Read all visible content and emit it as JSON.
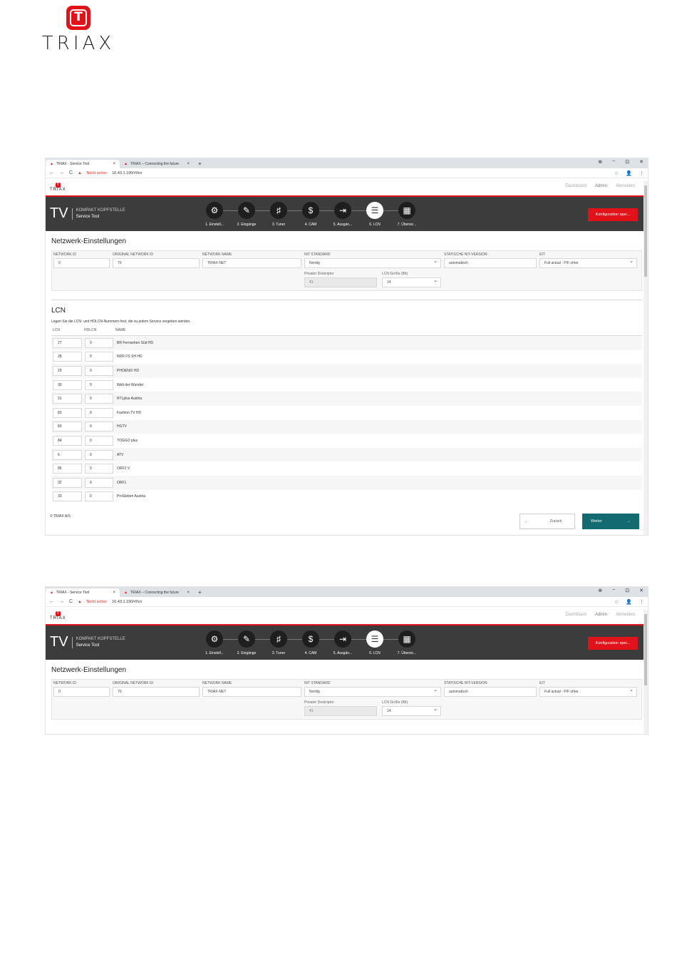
{
  "document_logo": {
    "mark": "T",
    "word": "TRIAX"
  },
  "browser": {
    "tabs": [
      {
        "title": "TRIAX - Service Tool"
      },
      {
        "title": "TRIAX – Connecting the future"
      }
    ],
    "new_tab": "+",
    "window_controls": [
      "⊗",
      "−",
      "⊡",
      "✕"
    ],
    "back": "←",
    "forward": "→",
    "reload": "C",
    "security_warning": "Nicht sicher",
    "url": "10.43.1.190/#/lcn",
    "star": "☆",
    "profile": "👤",
    "menu": "⋮"
  },
  "app": {
    "mini_logo_mark": "T",
    "mini_logo_word": "TRIAX",
    "top_links": [
      "Dashboard",
      "Admin",
      "Abmelden"
    ],
    "brand": {
      "tv": "TV",
      "line1": "KOMPAKT KOPFSTELLE",
      "line2": "Service Tool"
    },
    "steps": [
      {
        "icon": "⚙",
        "label": "1. Einstell..."
      },
      {
        "icon": "✎",
        "label": "2. Eingänge"
      },
      {
        "icon": "♯",
        "label": "3. Tuner"
      },
      {
        "icon": "$",
        "label": "4. CAM"
      },
      {
        "icon": "⇥",
        "label": "5. Ausgän..."
      },
      {
        "icon": "☰",
        "label": "6. LCN"
      },
      {
        "icon": "▦",
        "label": "7. Übersic..."
      }
    ],
    "save_button": "Konfiguration spei...",
    "network": {
      "title": "Netzwerk-Einstellungen",
      "labels": {
        "network_id": "NETWORK ID",
        "original_network_id": "ORIGINAL NETWORK ID",
        "network_name": "NETWORK NAME",
        "nit_standard": "NIT STANDARD",
        "static_nit": "STATISCHE NIT-VERSION",
        "eit": "EIT",
        "private_descriptor": "Privater Deskriptor",
        "lcn_size": "LCN Größe (Bit)"
      },
      "values": {
        "network_id": "0",
        "original_network_id": "70",
        "network_name": "TRIAX-NET",
        "nit_standard": "Nordig",
        "static_nit": "automatisch",
        "eit": "Full actual - P/F other",
        "private_descriptor": "41",
        "lcn_size": "14"
      }
    },
    "lcn": {
      "title": "LCN",
      "description": "Legen Sie die LCN- und HDLCN-Nummern fest, die zu jedem Service vergeben werden.",
      "headers": {
        "lcn": "LCN",
        "hdlcn": "HDLCN",
        "name": "NAME"
      },
      "rows": [
        {
          "lcn": "27",
          "hdlcn": "0",
          "name": "BR Fernsehen Süd HD"
        },
        {
          "lcn": "28",
          "hdlcn": "0",
          "name": "NDR FS SH HD"
        },
        {
          "lcn": "29",
          "hdlcn": "0",
          "name": "PHOENIX HD"
        },
        {
          "lcn": "30",
          "hdlcn": "0",
          "name": "Welt der Wunder"
        },
        {
          "lcn": "31",
          "hdlcn": "0",
          "name": "RTLplus Austria"
        },
        {
          "lcn": "82",
          "hdlcn": "0",
          "name": "Fashion TV HD"
        },
        {
          "lcn": "83",
          "hdlcn": "0",
          "name": "HGTV"
        },
        {
          "lcn": "84",
          "hdlcn": "0",
          "name": "TOGGO plus"
        },
        {
          "lcn": "6",
          "hdlcn": "0",
          "name": "ATV"
        },
        {
          "lcn": "85",
          "hdlcn": "0",
          "name": "ORF2 V"
        },
        {
          "lcn": "32",
          "hdlcn": "0",
          "name": "ORF1"
        },
        {
          "lcn": "33",
          "hdlcn": "0",
          "name": "ProSieben Austria"
        }
      ]
    },
    "footer": {
      "copyright": "© TRIAX A/S",
      "back_label": "Zurück",
      "back_arrow": "←",
      "next_label": "Weiter",
      "next_arrow": "→"
    }
  }
}
